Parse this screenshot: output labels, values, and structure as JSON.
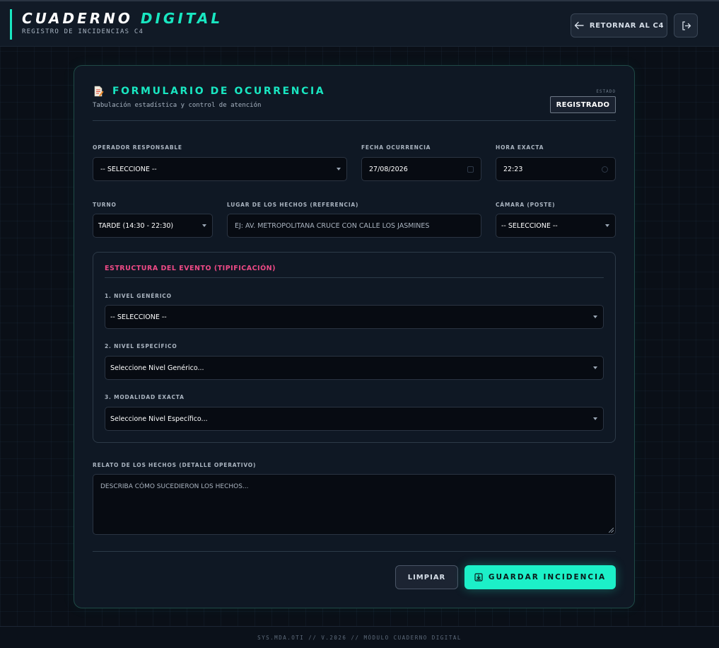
{
  "header": {
    "title_main": "CUADERNO",
    "title_accent": "DIGITAL",
    "subtitle": "REGISTRO DE INCIDENCIAS C4",
    "return_label": "RETORNAR AL C4"
  },
  "form": {
    "title": "FORMULARIO DE OCURRENCIA",
    "subtitle": "Tabulación estadística y control de atención",
    "state_label": "ESTADO",
    "state_value": "REGISTRADO",
    "operador": {
      "label": "OPERADOR RESPONSABLE",
      "value": "-- SELECCIONE --"
    },
    "fecha": {
      "label": "FECHA OCURRENCIA",
      "value": "27/08/2026"
    },
    "hora": {
      "label": "HORA EXACTA",
      "value": "22:23"
    },
    "turno": {
      "label": "TURNO",
      "value": "TARDE (14:30 - 22:30)"
    },
    "lugar": {
      "label": "LUGAR DE LOS HECHOS (REFERENCIA)",
      "placeholder": "EJ: AV. METROPOLITANA CRUCE CON CALLE LOS JASMINES"
    },
    "camara": {
      "label": "CÁMARA (POSTE)",
      "value": "-- SELECCIONE --"
    },
    "estructura": {
      "title": "ESTRUCTURA DEL EVENTO (TIPIFICACIÓN)",
      "generico": {
        "label": "1. NIVEL GENÉRICO",
        "value": "-- SELECCIONE --"
      },
      "especifico": {
        "label": "2. NIVEL ESPECÍFICO",
        "value": "Seleccione Nivel Genérico..."
      },
      "modalidad": {
        "label": "3. MODALIDAD EXACTA",
        "value": "Seleccione Nivel Específico..."
      }
    },
    "relato": {
      "label": "RELATO DE LOS HECHOS (DETALLE OPERATIVO)",
      "placeholder": "DESCRIBA CÓMO SUCEDIERON LOS HECHOS..."
    },
    "clear_label": "LIMPIAR",
    "save_label": "GUARDAR INCIDENCIA"
  },
  "footer": {
    "text": "SYS.MDA.OTI // V.2026 // MÓDULO CUADERNO DIGITAL"
  },
  "colors": {
    "accent": "#19e6c1",
    "section_title": "#ee4a86",
    "background": "#0a0f17"
  }
}
